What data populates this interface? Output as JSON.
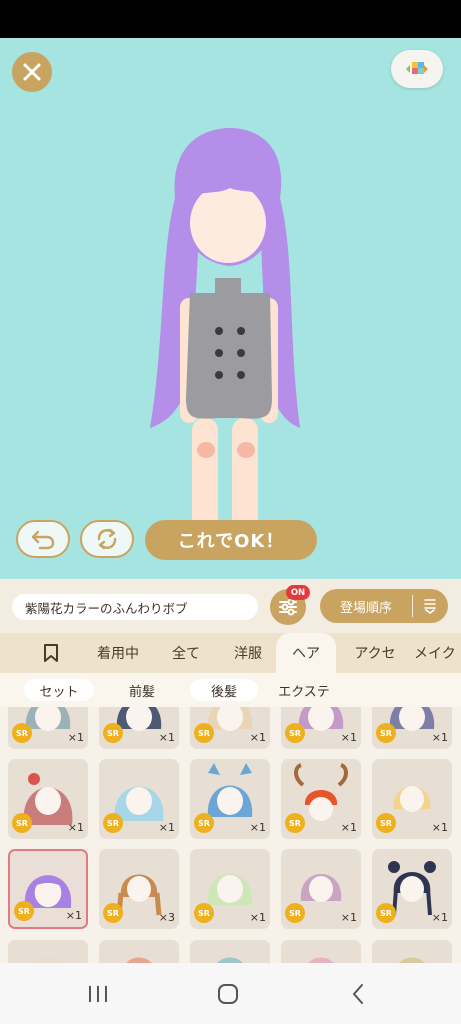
{
  "colors": {
    "stage_bg": "#a5e4e0",
    "gold": "#c9a460",
    "badge_red": "#e33b3b",
    "sr_badge": "#efb01e",
    "selected_border": "#e27a84"
  },
  "top": {
    "close_icon": "close-icon",
    "view_icon": "layout-toggle-icon"
  },
  "actions": {
    "undo_icon": "undo-icon",
    "random_icon": "shuffle-icon",
    "ok_label": "これでOK！"
  },
  "filter": {
    "item_name": "紫陽花カラーのふんわりボブ",
    "filter_icon": "sliders-icon",
    "filter_badge": "ON",
    "sort_label": "登場順序",
    "sort_icon": "sort-icon"
  },
  "tabs": [
    {
      "label": "",
      "icon": "bookmark-icon"
    },
    {
      "label": "着用中"
    },
    {
      "label": "全て"
    },
    {
      "label": "洋服"
    },
    {
      "label": "ヘア",
      "active": true
    },
    {
      "label": "アクセ"
    },
    {
      "label": "メイク"
    }
  ],
  "subtabs": [
    {
      "label": "セット"
    },
    {
      "label": "前髪"
    },
    {
      "label": "後髪"
    },
    {
      "label": "エクステ"
    }
  ],
  "items": [
    {
      "rarity": "SR",
      "count": "×1"
    },
    {
      "rarity": "SR",
      "count": "×1"
    },
    {
      "rarity": "SR",
      "count": "×1"
    },
    {
      "rarity": "SR",
      "count": "×1"
    },
    {
      "rarity": "SR",
      "count": "×1"
    },
    {
      "rarity": "SR",
      "count": "×1"
    },
    {
      "rarity": "SR",
      "count": "×1"
    },
    {
      "rarity": "SR",
      "count": "×1"
    },
    {
      "rarity": "SR",
      "count": "×1"
    },
    {
      "rarity": "SR",
      "count": "×1"
    },
    {
      "rarity": "SR",
      "count": "×1",
      "selected": true
    },
    {
      "rarity": "SR",
      "count": "×3"
    },
    {
      "rarity": "SR",
      "count": "×1"
    },
    {
      "rarity": "SR",
      "count": "×1"
    },
    {
      "rarity": "SR",
      "count": "×1"
    },
    {
      "rarity": "",
      "count": ""
    },
    {
      "rarity": "",
      "count": ""
    },
    {
      "rarity": "",
      "count": ""
    },
    {
      "rarity": "",
      "count": ""
    },
    {
      "rarity": "",
      "count": ""
    }
  ],
  "nav": {
    "recents_icon": "recents-icon",
    "home_icon": "home-icon",
    "back_icon": "back-icon"
  }
}
